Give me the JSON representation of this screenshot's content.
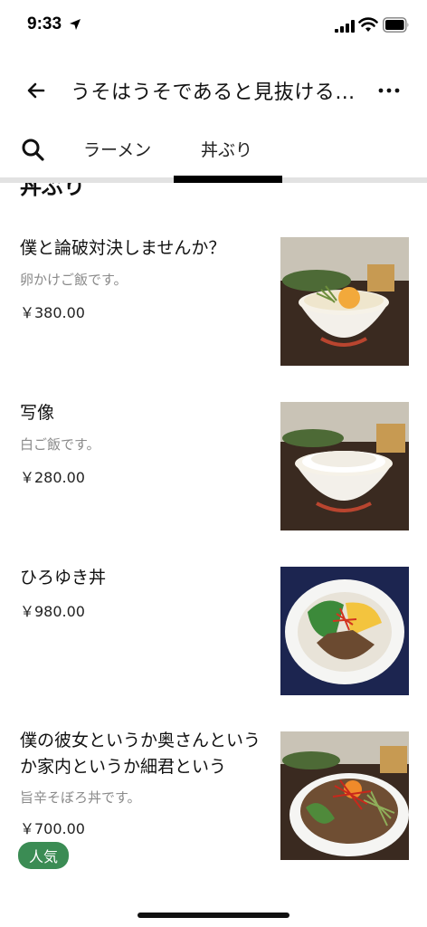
{
  "status_bar": {
    "time": "9:33",
    "icons": [
      "location-arrow-icon",
      "cellular-signal-icon",
      "wifi-icon",
      "battery-icon"
    ]
  },
  "nav": {
    "title": "うそはうそであると見抜ける…",
    "back_icon": "back-arrow-icon",
    "more_icon": "more-icon"
  },
  "tabs": {
    "search_icon": "search-icon",
    "items": [
      {
        "label": "ラーメン",
        "active": false
      },
      {
        "label": "丼ぶり",
        "active": true
      }
    ]
  },
  "section": {
    "title": "丼ぶり"
  },
  "menu_items": [
    {
      "name": "僕と論破対決しませんか？",
      "description": "卵かけご飯です。",
      "price": "￥380.00",
      "badge": ""
    },
    {
      "name": "写像",
      "description": "白ご飯です。",
      "price": "￥280.00",
      "badge": ""
    },
    {
      "name": "ひろゆき丼",
      "description": "",
      "price": "￥980.00",
      "badge": ""
    },
    {
      "name": "僕の彼女というか奥さんというか家内というか細君という",
      "description": "旨辛そぼろ丼です。",
      "price": "￥700.00",
      "badge": "人気"
    }
  ],
  "colors": {
    "badge": "#3b8c54",
    "tab_indicator": "#000000",
    "description": "#8a8a8a"
  }
}
